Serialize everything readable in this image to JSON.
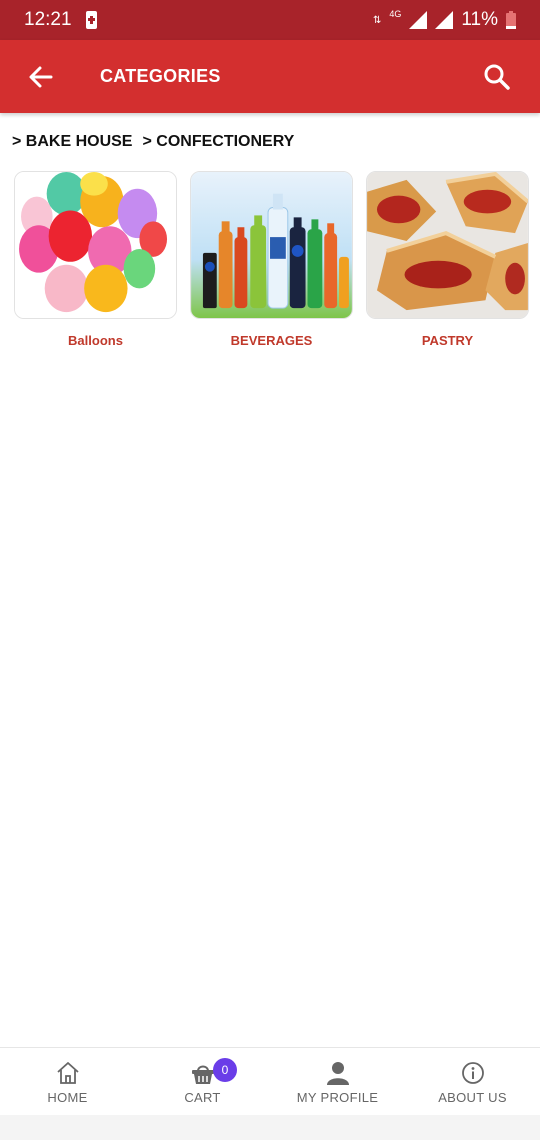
{
  "status_bar": {
    "time": "12:21",
    "network": "4G",
    "battery": "11%"
  },
  "app_bar": {
    "title": "CATEGORIES",
    "color": "#d32f2f"
  },
  "breadcrumb": [
    {
      "label": "> BAKE HOUSE"
    },
    {
      "label": "> CONFECTIONERY"
    }
  ],
  "categories": [
    {
      "label": "Balloons",
      "icon": "balloons-image"
    },
    {
      "label": "BEVERAGES",
      "icon": "beverages-image"
    },
    {
      "label": "PASTRY",
      "icon": "pastry-image"
    }
  ],
  "bottom_nav": {
    "home": {
      "label": "HOME",
      "icon": "home-icon"
    },
    "cart": {
      "label": "CART",
      "icon": "cart-icon",
      "badge": "0"
    },
    "profile": {
      "label": "MY PROFILE",
      "icon": "person-icon"
    },
    "about": {
      "label": "ABOUT US",
      "icon": "info-icon"
    }
  },
  "colors": {
    "status_bar": "#a8232a",
    "accent": "#d32f2f",
    "category_label": "#c0392b",
    "badge": "#6a3de8"
  }
}
